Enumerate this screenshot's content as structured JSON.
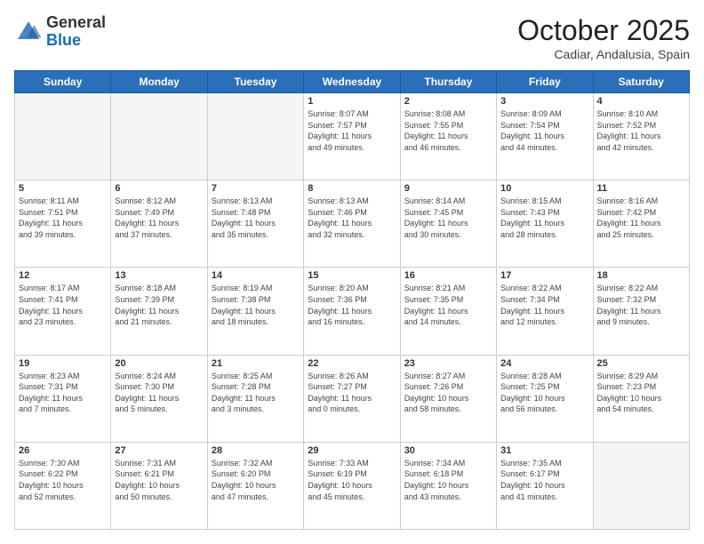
{
  "header": {
    "logo_general": "General",
    "logo_blue": "Blue",
    "month_title": "October 2025",
    "location": "Cadiar, Andalusia, Spain"
  },
  "days_of_week": [
    "Sunday",
    "Monday",
    "Tuesday",
    "Wednesday",
    "Thursday",
    "Friday",
    "Saturday"
  ],
  "weeks": [
    [
      {
        "day": "",
        "content": ""
      },
      {
        "day": "",
        "content": ""
      },
      {
        "day": "",
        "content": ""
      },
      {
        "day": "1",
        "content": "Sunrise: 8:07 AM\nSunset: 7:57 PM\nDaylight: 11 hours\nand 49 minutes."
      },
      {
        "day": "2",
        "content": "Sunrise: 8:08 AM\nSunset: 7:55 PM\nDaylight: 11 hours\nand 46 minutes."
      },
      {
        "day": "3",
        "content": "Sunrise: 8:09 AM\nSunset: 7:54 PM\nDaylight: 11 hours\nand 44 minutes."
      },
      {
        "day": "4",
        "content": "Sunrise: 8:10 AM\nSunset: 7:52 PM\nDaylight: 11 hours\nand 42 minutes."
      }
    ],
    [
      {
        "day": "5",
        "content": "Sunrise: 8:11 AM\nSunset: 7:51 PM\nDaylight: 11 hours\nand 39 minutes."
      },
      {
        "day": "6",
        "content": "Sunrise: 8:12 AM\nSunset: 7:49 PM\nDaylight: 11 hours\nand 37 minutes."
      },
      {
        "day": "7",
        "content": "Sunrise: 8:13 AM\nSunset: 7:48 PM\nDaylight: 11 hours\nand 35 minutes."
      },
      {
        "day": "8",
        "content": "Sunrise: 8:13 AM\nSunset: 7:46 PM\nDaylight: 11 hours\nand 32 minutes."
      },
      {
        "day": "9",
        "content": "Sunrise: 8:14 AM\nSunset: 7:45 PM\nDaylight: 11 hours\nand 30 minutes."
      },
      {
        "day": "10",
        "content": "Sunrise: 8:15 AM\nSunset: 7:43 PM\nDaylight: 11 hours\nand 28 minutes."
      },
      {
        "day": "11",
        "content": "Sunrise: 8:16 AM\nSunset: 7:42 PM\nDaylight: 11 hours\nand 25 minutes."
      }
    ],
    [
      {
        "day": "12",
        "content": "Sunrise: 8:17 AM\nSunset: 7:41 PM\nDaylight: 11 hours\nand 23 minutes."
      },
      {
        "day": "13",
        "content": "Sunrise: 8:18 AM\nSunset: 7:39 PM\nDaylight: 11 hours\nand 21 minutes."
      },
      {
        "day": "14",
        "content": "Sunrise: 8:19 AM\nSunset: 7:38 PM\nDaylight: 11 hours\nand 18 minutes."
      },
      {
        "day": "15",
        "content": "Sunrise: 8:20 AM\nSunset: 7:36 PM\nDaylight: 11 hours\nand 16 minutes."
      },
      {
        "day": "16",
        "content": "Sunrise: 8:21 AM\nSunset: 7:35 PM\nDaylight: 11 hours\nand 14 minutes."
      },
      {
        "day": "17",
        "content": "Sunrise: 8:22 AM\nSunset: 7:34 PM\nDaylight: 11 hours\nand 12 minutes."
      },
      {
        "day": "18",
        "content": "Sunrise: 8:22 AM\nSunset: 7:32 PM\nDaylight: 11 hours\nand 9 minutes."
      }
    ],
    [
      {
        "day": "19",
        "content": "Sunrise: 8:23 AM\nSunset: 7:31 PM\nDaylight: 11 hours\nand 7 minutes."
      },
      {
        "day": "20",
        "content": "Sunrise: 8:24 AM\nSunset: 7:30 PM\nDaylight: 11 hours\nand 5 minutes."
      },
      {
        "day": "21",
        "content": "Sunrise: 8:25 AM\nSunset: 7:28 PM\nDaylight: 11 hours\nand 3 minutes."
      },
      {
        "day": "22",
        "content": "Sunrise: 8:26 AM\nSunset: 7:27 PM\nDaylight: 11 hours\nand 0 minutes."
      },
      {
        "day": "23",
        "content": "Sunrise: 8:27 AM\nSunset: 7:26 PM\nDaylight: 10 hours\nand 58 minutes."
      },
      {
        "day": "24",
        "content": "Sunrise: 8:28 AM\nSunset: 7:25 PM\nDaylight: 10 hours\nand 56 minutes."
      },
      {
        "day": "25",
        "content": "Sunrise: 8:29 AM\nSunset: 7:23 PM\nDaylight: 10 hours\nand 54 minutes."
      }
    ],
    [
      {
        "day": "26",
        "content": "Sunrise: 7:30 AM\nSunset: 6:22 PM\nDaylight: 10 hours\nand 52 minutes."
      },
      {
        "day": "27",
        "content": "Sunrise: 7:31 AM\nSunset: 6:21 PM\nDaylight: 10 hours\nand 50 minutes."
      },
      {
        "day": "28",
        "content": "Sunrise: 7:32 AM\nSunset: 6:20 PM\nDaylight: 10 hours\nand 47 minutes."
      },
      {
        "day": "29",
        "content": "Sunrise: 7:33 AM\nSunset: 6:19 PM\nDaylight: 10 hours\nand 45 minutes."
      },
      {
        "day": "30",
        "content": "Sunrise: 7:34 AM\nSunset: 6:18 PM\nDaylight: 10 hours\nand 43 minutes."
      },
      {
        "day": "31",
        "content": "Sunrise: 7:35 AM\nSunset: 6:17 PM\nDaylight: 10 hours\nand 41 minutes."
      },
      {
        "day": "",
        "content": ""
      }
    ]
  ]
}
